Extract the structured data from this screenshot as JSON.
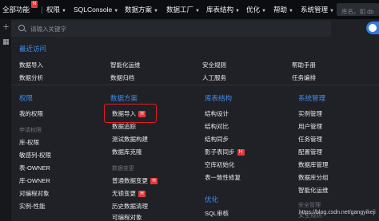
{
  "topbar": {
    "apps": "全部功能",
    "apps_badge": "N",
    "items": [
      "权限",
      "SQLConsole",
      "数据方案",
      "数据工厂",
      "库表结构",
      "优化",
      "帮助",
      "系统管理"
    ],
    "search_placeholder": "库名，如 db"
  },
  "search": {
    "placeholder": "请输入关键字"
  },
  "recent": {
    "title": "最近访问",
    "col1": [
      "数据导入",
      "数据分析"
    ],
    "col2": [
      "智能化运维",
      "数据归档"
    ],
    "col3": [
      "安全规则",
      "人工服务"
    ],
    "col4": [
      "帮助手册",
      "任务编排"
    ]
  },
  "permission": {
    "title": "权限",
    "items": [
      "我的权限"
    ],
    "subtitle": "申请权限",
    "sub_items": [
      "库-权限",
      "敏感列-权限",
      "表-OWNER",
      "库-OWNER",
      "对编程对象",
      "实例-性能"
    ]
  },
  "data_solution": {
    "title": "数据方案",
    "items": [
      "数据导入",
      "数据追踪",
      "测试数据构建",
      "数据库克隆"
    ],
    "tag": "H",
    "subtitle": "数据变更",
    "sub_items": [
      "普通数据变更",
      "无锁变更",
      "历史数据清理",
      "可编程对象"
    ]
  },
  "table_struct": {
    "title": "库表结构",
    "items": [
      "结构设计",
      "结构对比",
      "结构同步",
      "影子表同步",
      "空库初始化",
      "表一致性修复"
    ],
    "tag": "H"
  },
  "optimize": {
    "title": "优化",
    "items": [
      "SQL审核"
    ]
  },
  "sys_admin": {
    "title": "系统管理",
    "items": [
      "实例管理",
      "用户管理",
      "任务管理",
      "配置管理",
      "数据库管理",
      "数据库分组",
      "智能化运维"
    ],
    "subtitle": "安全管理",
    "sub_items": [
      "安全规则"
    ]
  },
  "watermark": "https://blog.csdn.net/gangyikeji"
}
